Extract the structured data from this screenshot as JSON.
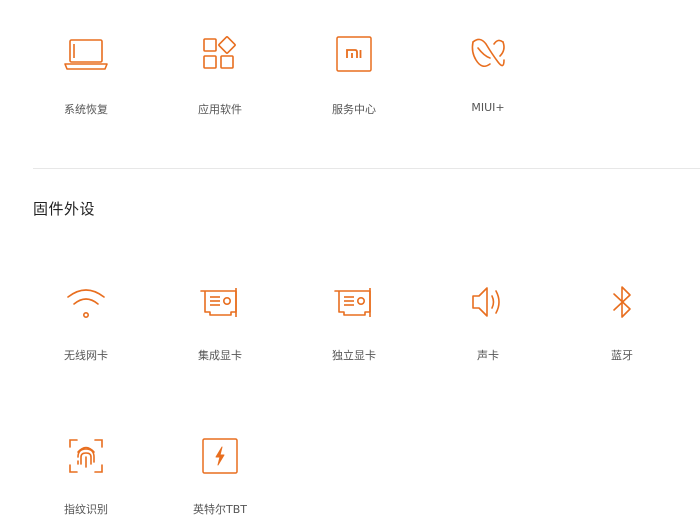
{
  "colors": {
    "accent": "#E86E1F",
    "label_text": "#555555",
    "title_text": "#222222",
    "divider": "#E7E7E7"
  },
  "top_tiles": [
    {
      "label": "系统恢复",
      "icon": "laptop-icon"
    },
    {
      "label": "应用软件",
      "icon": "apps-icon"
    },
    {
      "label": "服务中心",
      "icon": "mi-logo-icon"
    },
    {
      "label": "MIUI+",
      "icon": "miui-plus-icon"
    }
  ],
  "firmware": {
    "title": "固件外设",
    "tiles": [
      {
        "label": "无线网卡",
        "icon": "wifi-icon"
      },
      {
        "label": "集成显卡",
        "icon": "graphics-card-icon"
      },
      {
        "label": "独立显卡",
        "icon": "graphics-card-icon"
      },
      {
        "label": "声卡",
        "icon": "speaker-icon"
      },
      {
        "label": "蓝牙",
        "icon": "bluetooth-icon"
      },
      {
        "label": "指纹识别",
        "icon": "fingerprint-icon"
      },
      {
        "label": "英特尔TBT",
        "icon": "thunderbolt-icon"
      }
    ]
  }
}
